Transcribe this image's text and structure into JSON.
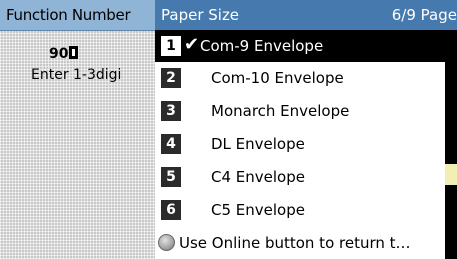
{
  "background_panel": {
    "title": "Function Number",
    "value": "90",
    "hint": "Enter 1-3digi"
  },
  "dialog": {
    "title": "Paper Size",
    "page_indicator": "6/9 Page",
    "items": [
      {
        "number": "1",
        "label": "Com-9 Envelope",
        "selected": true
      },
      {
        "number": "2",
        "label": "Com-10 Envelope",
        "selected": false
      },
      {
        "number": "3",
        "label": "Monarch Envelope",
        "selected": false
      },
      {
        "number": "4",
        "label": "DL Envelope",
        "selected": false
      },
      {
        "number": "5",
        "label": "C4 Envelope",
        "selected": false
      },
      {
        "number": "6",
        "label": "C5 Envelope",
        "selected": false
      }
    ],
    "online_hint": "Use Online button to return t…",
    "check_mark": "✔"
  },
  "colors": {
    "dialog_header": "#4679ad",
    "background_header": "#8fb4d6",
    "selected_item": "#000000",
    "strip_highlight": "#f3efb2"
  }
}
